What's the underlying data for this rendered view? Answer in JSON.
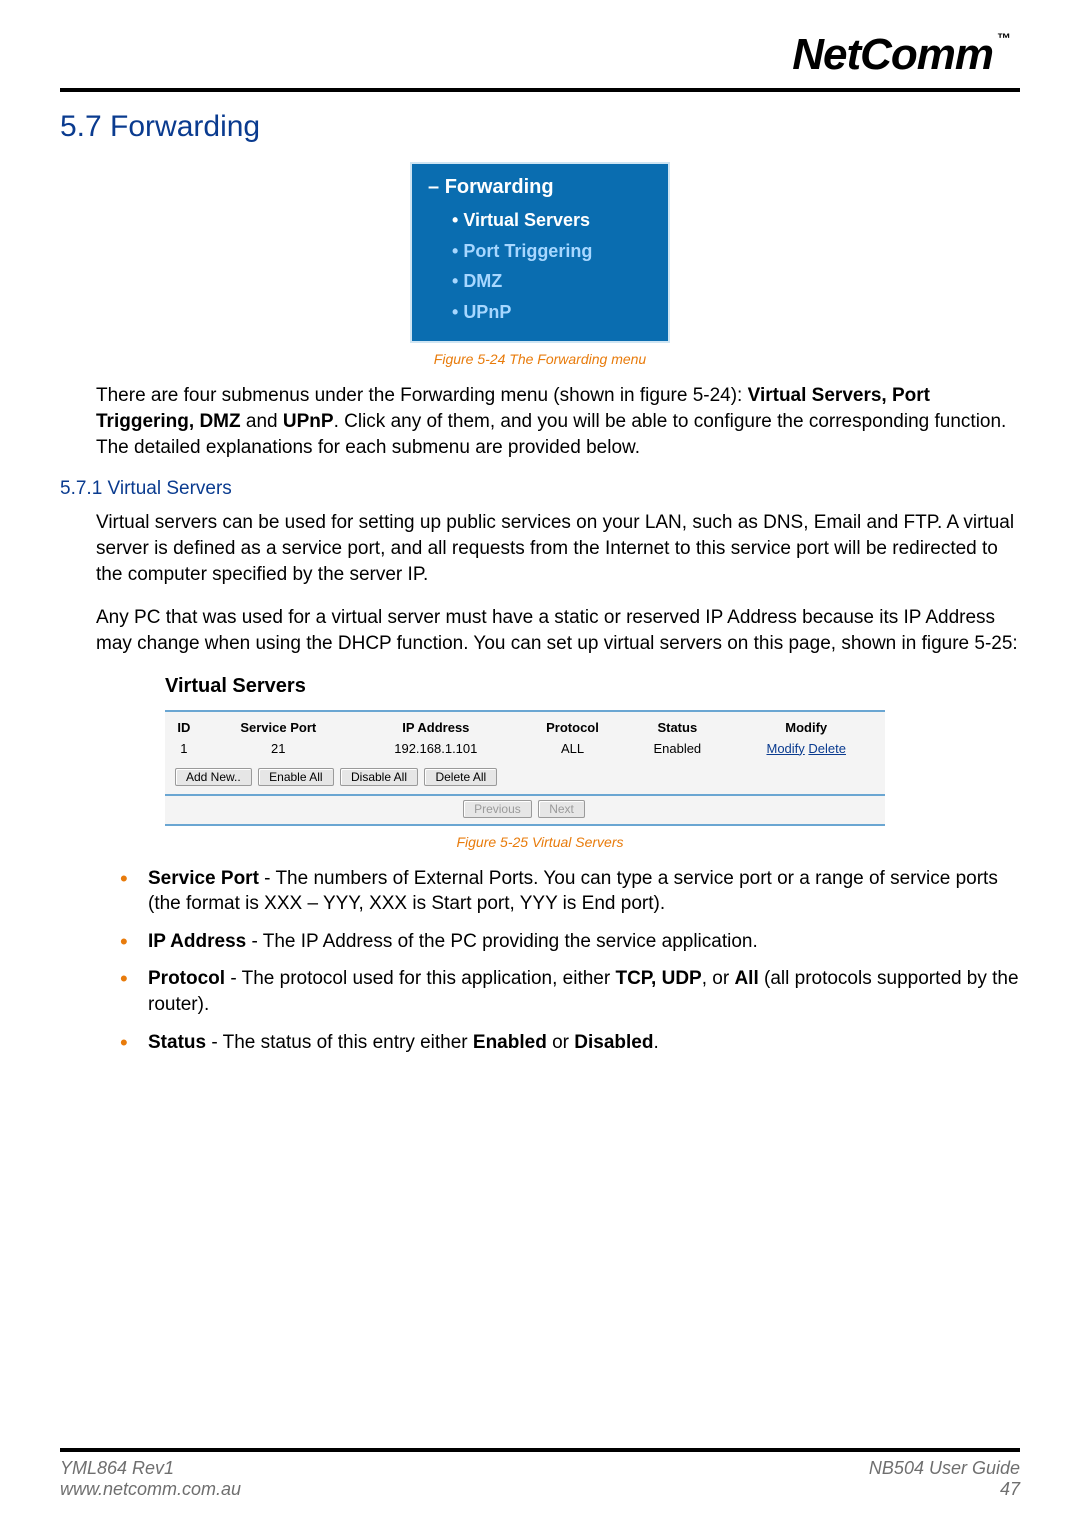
{
  "brand": {
    "name": "NetComm",
    "tm": "™"
  },
  "section_heading": "5.7 Forwarding",
  "menu": {
    "parent": "Forwarding",
    "items": [
      {
        "label": "Virtual Servers",
        "active": true
      },
      {
        "label": "Port Triggering",
        "active": false
      },
      {
        "label": "DMZ",
        "active": false
      },
      {
        "label": "UPnP",
        "active": false
      }
    ]
  },
  "captions": {
    "menu": "Figure 5-24 The Forwarding menu",
    "vs": "Figure 5-25 Virtual Servers"
  },
  "paragraphs": {
    "intro_pre": "There are four submenus under the Forwarding menu (shown in figure 5-24): ",
    "intro_bold1": "Virtual Servers, Port Triggering, DMZ",
    "intro_mid": " and ",
    "intro_bold2": "UPnP",
    "intro_post": ". Click any of them, and you will be able to configure the corresponding function. The detailed explanations for each submenu are provided below.",
    "vs_intro": "Virtual servers can be used for setting up public services on your LAN, such as DNS, Email and FTP. A virtual server is defined as a service port, and all requests from the Internet to this service port will be redirected to the computer specified by the server IP.",
    "vs_note": "Any PC that was used for a virtual server must have a static or reserved IP Address because its IP Address may change when using the DHCP function. You can set up virtual servers on this page, shown in figure 5-25:"
  },
  "sub_heading": "5.7.1 Virtual Servers",
  "virtual_servers": {
    "title": "Virtual Servers",
    "columns": [
      "ID",
      "Service Port",
      "IP Address",
      "Protocol",
      "Status",
      "Modify"
    ],
    "rows": [
      {
        "id": "1",
        "service_port": "21",
        "ip_address": "192.168.1.101",
        "protocol": "ALL",
        "status": "Enabled",
        "modify": "Modify",
        "delete": "Delete"
      }
    ],
    "buttons": {
      "add_new": "Add New..",
      "enable_all": "Enable All",
      "disable_all": "Disable All",
      "delete_all": "Delete All",
      "previous": "Previous",
      "next": "Next"
    }
  },
  "fields": [
    {
      "term": "Service Port",
      "desc": " - The numbers of External Ports. You can type a service port or a range of service ports (the format is XXX – YYY, XXX is Start port, YYY is End port)."
    },
    {
      "term": "IP Address",
      "desc": " - The IP Address of the PC providing the service application."
    },
    {
      "term": "Protocol",
      "desc_pre": " - The protocol used for this application, either ",
      "desc_bold": "TCP, UDP",
      "desc_mid": ", or ",
      "desc_bold2": "All",
      "desc_post": " (all protocols supported by the router)."
    },
    {
      "term": "Status",
      "desc_pre": " - The status of this entry either ",
      "desc_bold": "Enabled",
      "desc_mid": " or ",
      "desc_bold2": "Disabled",
      "desc_post": "."
    }
  ],
  "footer": {
    "left_line1": "YML864 Rev1",
    "left_line2": "www.netcomm.com.au",
    "right_line1": "NB504 User Guide",
    "right_line2": "47"
  }
}
